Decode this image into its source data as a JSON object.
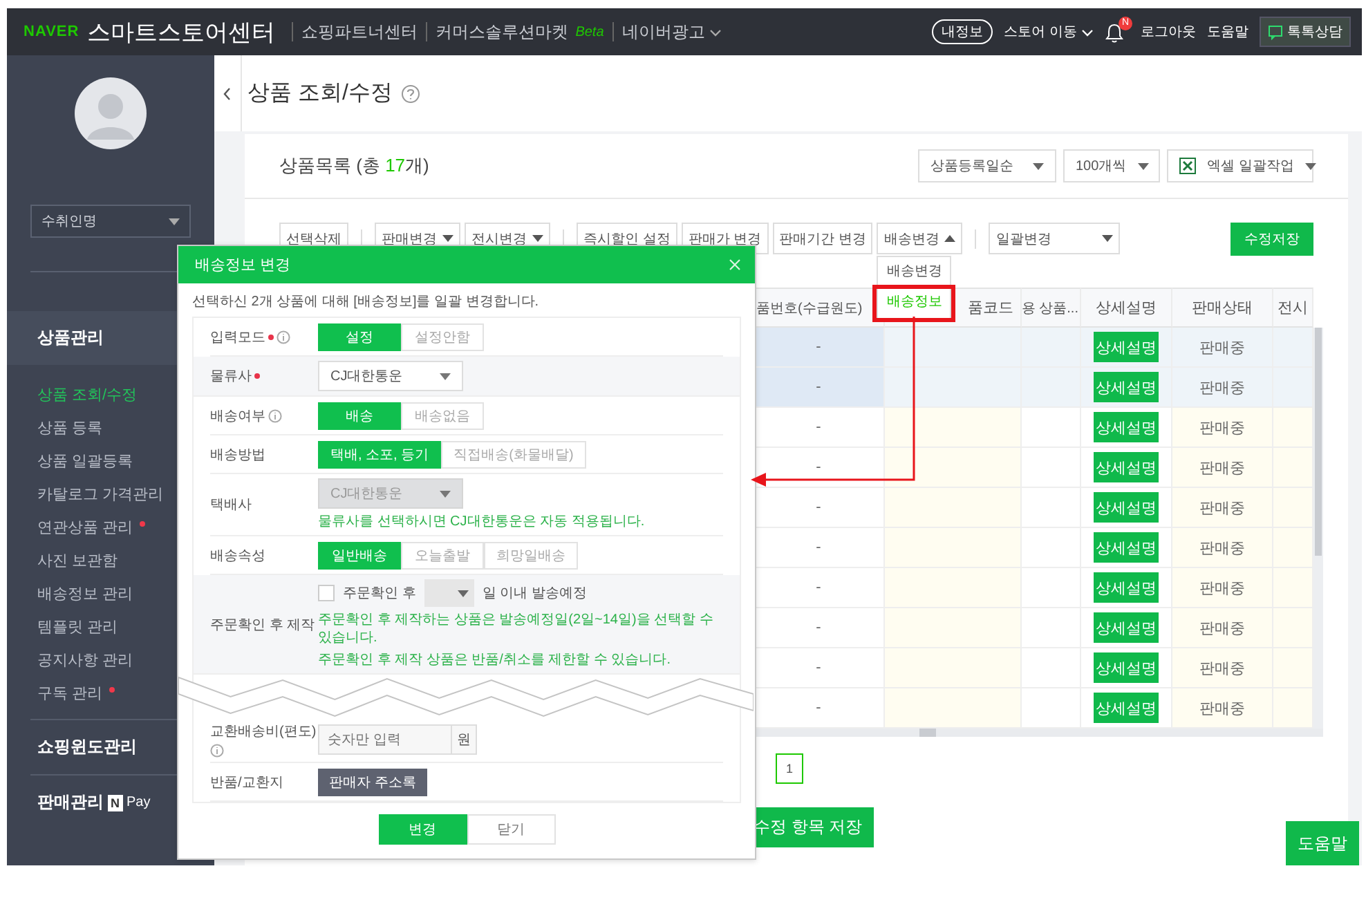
{
  "topbar": {
    "logo": "NAVER",
    "title": "스마트스토어센터",
    "links": [
      {
        "label": "쇼핑파트너센터",
        "kind": "plain"
      },
      {
        "label": "커머스솔루션마켓",
        "kind": "badge",
        "badge": "Beta"
      },
      {
        "label": "네이버광고",
        "kind": "dropdown"
      }
    ],
    "my_info": "내정보",
    "store_move": "스토어 이동",
    "bell_badge": "N",
    "logout": "로그아웃",
    "help": "도움말",
    "talk": "톡톡상담"
  },
  "sidebar": {
    "search_select": "수취인명",
    "sections": [
      {
        "label": "상품관리",
        "expanded": true,
        "items": [
          {
            "label": "상품 조회/수정",
            "selected": true,
            "new": false
          },
          {
            "label": "상품 등록",
            "selected": false,
            "new": false
          },
          {
            "label": "상품 일괄등록",
            "selected": false,
            "new": false
          },
          {
            "label": "카탈로그 가격관리",
            "selected": false,
            "new": false
          },
          {
            "label": "연관상품 관리",
            "selected": false,
            "new": true
          },
          {
            "label": "사진 보관함",
            "selected": false,
            "new": false
          },
          {
            "label": "배송정보 관리",
            "selected": false,
            "new": false
          },
          {
            "label": "템플릿 관리",
            "selected": false,
            "new": false
          },
          {
            "label": "공지사항 관리",
            "selected": false,
            "new": false
          },
          {
            "label": "구독 관리",
            "selected": false,
            "new": true
          }
        ]
      },
      {
        "label": "쇼핑윈도관리",
        "expanded": false
      },
      {
        "label": "판매관리",
        "expanded": false,
        "pay_mark": "N",
        "pay_text": "Pay"
      }
    ]
  },
  "page": {
    "title": "상품 조회/수정"
  },
  "list": {
    "title": "상품목록",
    "count_prefix": "(총",
    "count": "17",
    "count_suffix": "개)",
    "selects": [
      {
        "label": "상품등록일순",
        "kind": "plain"
      },
      {
        "label": "100개씩",
        "kind": "plain"
      },
      {
        "label": "엑셀 일괄작업",
        "kind": "excel"
      }
    ]
  },
  "toolbar": {
    "groups": [
      [
        {
          "label": "선택삭제",
          "kind": "button"
        }
      ],
      [
        {
          "label": "판매변경",
          "kind": "dropdown",
          "expanded": false
        },
        {
          "label": "전시변경",
          "kind": "dropdown",
          "expanded": false
        }
      ],
      [
        {
          "label": "즉시할인 설정",
          "kind": "button"
        },
        {
          "label": "판매가 변경",
          "kind": "button"
        },
        {
          "label": "판매기간 변경",
          "kind": "button"
        },
        {
          "label": "배송변경",
          "kind": "dropdown",
          "expanded": true,
          "menu": [
            {
              "label": "배송변경",
              "selected": false
            },
            {
              "label": "배송정보",
              "selected": true
            }
          ]
        }
      ],
      [
        {
          "label": "일괄변경",
          "kind": "wide-dropdown",
          "expanded": false
        }
      ]
    ],
    "save": "수정저장"
  },
  "table": {
    "columns": [
      "품번호(수급원도)",
      "품코드",
      "용 상품...",
      "상세설명",
      "판매상태",
      "전시"
    ],
    "rows": [
      {
        "selected": true,
        "product_no": "-",
        "detail_button": "상세설명",
        "status": "판매중"
      },
      {
        "selected": true,
        "product_no": "-",
        "detail_button": "상세설명",
        "status": "판매중"
      },
      {
        "selected": false,
        "product_no": "-",
        "detail_button": "상세설명",
        "status": "판매중"
      },
      {
        "selected": false,
        "product_no": "-",
        "detail_button": "상세설명",
        "status": "판매중"
      },
      {
        "selected": false,
        "product_no": "-",
        "detail_button": "상세설명",
        "status": "판매중"
      },
      {
        "selected": false,
        "product_no": "-",
        "detail_button": "상세설명",
        "status": "판매중"
      },
      {
        "selected": false,
        "product_no": "-",
        "detail_button": "상세설명",
        "status": "판매중"
      },
      {
        "selected": false,
        "product_no": "-",
        "detail_button": "상세설명",
        "status": "판매중"
      },
      {
        "selected": false,
        "product_no": "-",
        "detail_button": "상세설명",
        "status": "판매중"
      },
      {
        "selected": false,
        "product_no": "-",
        "detail_button": "상세설명",
        "status": "판매중"
      }
    ]
  },
  "pagination": [
    {
      "label": "1",
      "selected": true
    }
  ],
  "save_changes": "수정 항목 저장",
  "help_button": "도움말",
  "modal": {
    "title": "배송정보 변경",
    "notice": "선택하신 2개 상품에 대해 [배송정보]를 일괄 변경합니다.",
    "rows": [
      {
        "kind": "toggle",
        "label": "입력모드",
        "required": true,
        "info": true,
        "highlighted": false,
        "options": [
          {
            "label": "설정",
            "selected": true
          },
          {
            "label": "설정안함",
            "selected": false
          }
        ]
      },
      {
        "kind": "select",
        "label": "물류사",
        "required": true,
        "info": false,
        "highlighted": true,
        "value": "CJ대한통운",
        "disabled": false
      },
      {
        "kind": "toggle",
        "label": "배송여부",
        "required": false,
        "info": true,
        "highlighted": false,
        "options": [
          {
            "label": "배송",
            "selected": true
          },
          {
            "label": "배송없음",
            "selected": false
          }
        ]
      },
      {
        "kind": "toggle",
        "label": "배송방법",
        "required": false,
        "info": false,
        "highlighted": false,
        "options": [
          {
            "label": "택배, 소포, 등기",
            "selected": true
          },
          {
            "label": "직접배송(화물배달)",
            "selected": false
          }
        ]
      },
      {
        "kind": "select",
        "label": "택배사",
        "required": false,
        "info": false,
        "highlighted": false,
        "value": "CJ대한통운",
        "disabled": true,
        "notes": [
          "물류사를 선택하시면 CJ대한통운은 자동 적용됩니다."
        ]
      },
      {
        "kind": "toggle",
        "label": "배송속성",
        "required": false,
        "info": false,
        "highlighted": false,
        "options": [
          {
            "label": "일반배송",
            "selected": true
          },
          {
            "label": "오늘출발",
            "selected": false
          },
          {
            "label": "희망일배송",
            "selected": false
          }
        ]
      },
      {
        "kind": "ship_days",
        "label": "주문확인 후 제작",
        "required": false,
        "info": false,
        "highlighted": true,
        "checked": false,
        "check_label": "주문확인 후",
        "suffix": "일 이내 발송예정",
        "notes": [
          "주문확인 후 제작하는 상품은 발송예정일(2일~14일)을 선택할 수 있습니다.",
          "주문확인 후 제작 상품은 반품/취소를 제한할 수 있습니다."
        ]
      },
      {
        "kind": "input",
        "label": "교환배송비(편도)",
        "required": false,
        "info": true,
        "highlighted": false,
        "placeholder": "숫자만 입력",
        "unit": "원"
      },
      {
        "kind": "button",
        "label": "반품/교환지",
        "required": false,
        "info": false,
        "highlighted": false,
        "button": "판매자 주소록"
      }
    ],
    "confirm": "변경",
    "close": "닫기"
  }
}
